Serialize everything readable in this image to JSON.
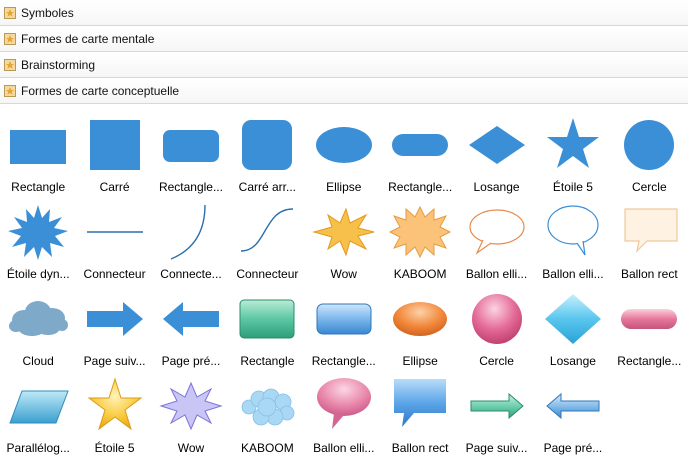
{
  "colors": {
    "primary": "#3b8fd6",
    "accent_yellow": "#f7c04a",
    "header_border": "#d8d8d8"
  },
  "panels": [
    {
      "label": "Symboles",
      "icon": "library-icon"
    },
    {
      "label": "Formes de carte mentale",
      "icon": "library-icon"
    },
    {
      "label": "Brainstorming",
      "icon": "library-icon"
    },
    {
      "label": "Formes de carte conceptuelle",
      "icon": "library-icon"
    }
  ],
  "shapes": [
    {
      "label": "Rectangle",
      "icon": "rectangle-icon"
    },
    {
      "label": "Carré",
      "icon": "square-icon"
    },
    {
      "label": "Rectangle...",
      "icon": "rounded-rectangle-icon"
    },
    {
      "label": "Carré arr...",
      "icon": "rounded-square-icon"
    },
    {
      "label": "Ellipse",
      "icon": "ellipse-icon"
    },
    {
      "label": "Rectangle...",
      "icon": "pill-rectangle-icon"
    },
    {
      "label": "Losange",
      "icon": "diamond-icon"
    },
    {
      "label": "Étoile 5",
      "icon": "star-icon"
    },
    {
      "label": "Cercle",
      "icon": "circle-icon"
    },
    {
      "label": "Étoile dyn...",
      "icon": "burst-star-icon"
    },
    {
      "label": "Connecteur",
      "icon": "straight-connector-icon"
    },
    {
      "label": "Connecte...",
      "icon": "curved-connector-icon"
    },
    {
      "label": "Connecteur",
      "icon": "s-curve-connector-icon"
    },
    {
      "label": "Wow",
      "icon": "wow-burst-icon"
    },
    {
      "label": "KABOOM",
      "icon": "kaboom-burst-icon"
    },
    {
      "label": "Ballon elli...",
      "icon": "ellipse-balloon-icon"
    },
    {
      "label": "Ballon elli...",
      "icon": "ellipse-balloon-blue-icon"
    },
    {
      "label": "Ballon rect",
      "icon": "rect-balloon-icon"
    },
    {
      "label": "Cloud",
      "icon": "cloud-icon"
    },
    {
      "label": "Page suiv...",
      "icon": "right-arrow-icon"
    },
    {
      "label": "Page pré...",
      "icon": "left-arrow-icon"
    },
    {
      "label": "Rectangle",
      "icon": "glossy-rectangle-green-icon"
    },
    {
      "label": "Rectangle...",
      "icon": "glossy-rounded-rectangle-icon"
    },
    {
      "label": "Ellipse",
      "icon": "glossy-ellipse-orange-icon"
    },
    {
      "label": "Cercle",
      "icon": "glossy-circle-pink-icon"
    },
    {
      "label": "Losange",
      "icon": "glossy-diamond-icon"
    },
    {
      "label": "Rectangle...",
      "icon": "glossy-pill-pink-icon"
    },
    {
      "label": "Parallélog...",
      "icon": "parallelogram-icon"
    },
    {
      "label": "Étoile 5",
      "icon": "glossy-star-yellow-icon"
    },
    {
      "label": "Wow",
      "icon": "wow-burst-purple-icon"
    },
    {
      "label": "KABOOM",
      "icon": "kaboom-cloud-blue-icon"
    },
    {
      "label": "Ballon elli...",
      "icon": "glossy-ellipse-balloon-pink-icon"
    },
    {
      "label": "Ballon rect",
      "icon": "glossy-rect-balloon-blue-icon"
    },
    {
      "label": "Page suiv...",
      "icon": "glossy-right-arrow-green-icon"
    },
    {
      "label": "Page pré...",
      "icon": "glossy-left-arrow-blue-icon"
    }
  ]
}
